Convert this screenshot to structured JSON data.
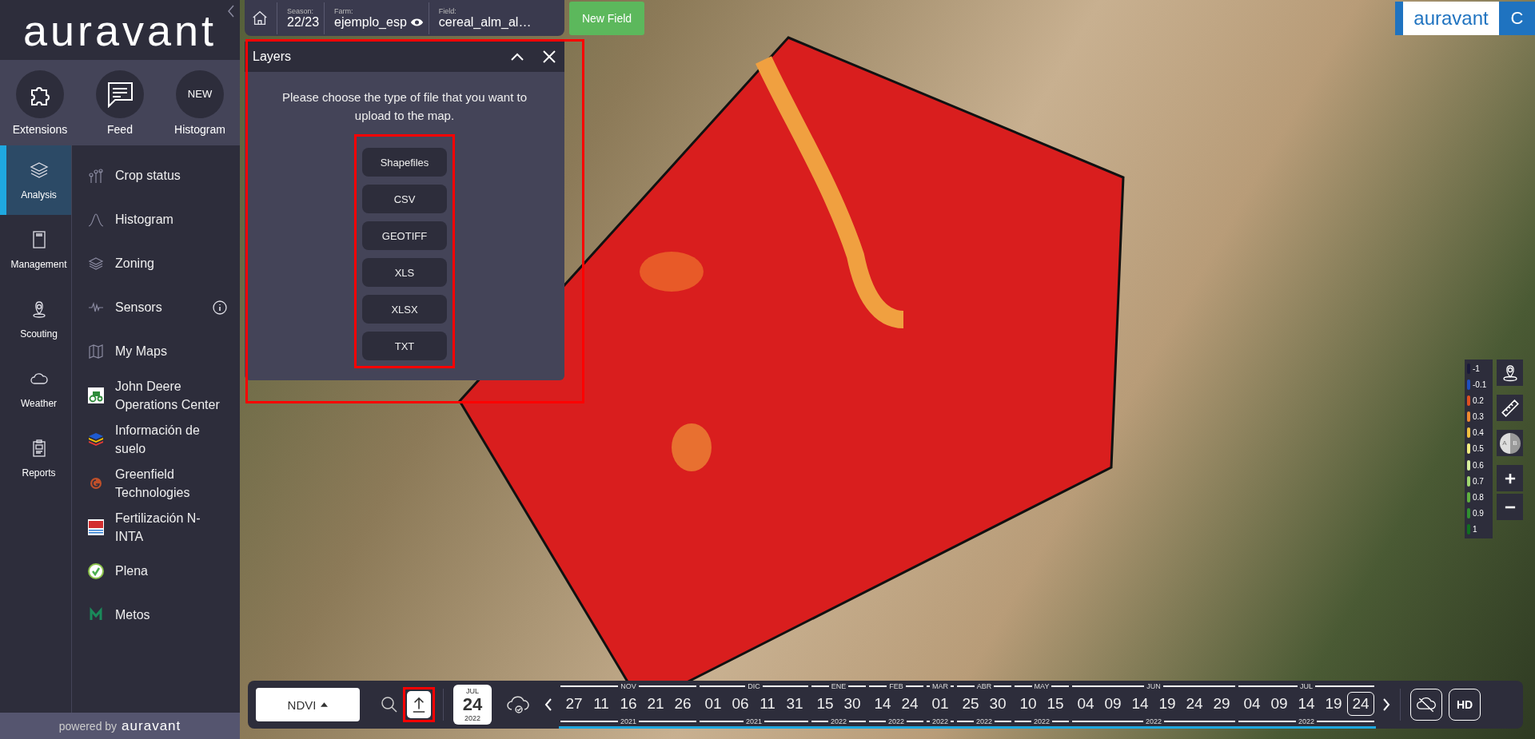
{
  "sidebar": {
    "logo": "auravant",
    "quick_actions": [
      {
        "label": "Extensions",
        "kind": "icon"
      },
      {
        "label": "Feed",
        "kind": "icon"
      },
      {
        "label": "Histogram",
        "kind": "text",
        "circle_text": "NEW"
      }
    ],
    "sections": [
      {
        "label": "Analysis",
        "selected": true
      },
      {
        "label": "Management",
        "selected": false
      },
      {
        "label": "Scouting",
        "selected": false
      },
      {
        "label": "Weather",
        "selected": false
      },
      {
        "label": "Reports",
        "selected": false
      }
    ],
    "menu": [
      {
        "label": "Crop status",
        "info": false
      },
      {
        "label": "Histogram",
        "info": false
      },
      {
        "label": "Zoning",
        "info": false
      },
      {
        "label": "Sensors",
        "info": true
      },
      {
        "label": "My Maps",
        "info": false
      },
      {
        "label": "John Deere Operations Center",
        "info": false
      },
      {
        "label": "Información de suelo",
        "info": false
      },
      {
        "label": "Greenfield Technologies",
        "info": false
      },
      {
        "label": "Fertilización N-INTA",
        "info": false
      },
      {
        "label": "Plena",
        "info": false
      },
      {
        "label": "Metos",
        "info": false
      }
    ],
    "footer": {
      "prefix": "powered by",
      "brand": "auravant"
    }
  },
  "breadcrumb": [
    {
      "label": "Season:",
      "value": "22/23"
    },
    {
      "label": "Farm:",
      "value": "ejemplo_esp"
    },
    {
      "label": "Field:",
      "value": "cereal_alm_al…"
    }
  ],
  "new_field_button": "New Field",
  "layers_panel": {
    "title": "Layers",
    "highlighted": true,
    "message": "Please choose the type of file that you want to upload to the map.",
    "options_highlighted": true,
    "options": [
      "Shapefiles",
      "CSV",
      "GEOTIFF",
      "XLS",
      "XLSX",
      "TXT"
    ]
  },
  "brand_badge": {
    "logo": "auravant",
    "letter": "C"
  },
  "legend": [
    {
      "value": "-1",
      "color": "#1a1a3a"
    },
    {
      "value": "-0.1",
      "color": "#1e4fc0"
    },
    {
      "value": "0.2",
      "color": "#e05020"
    },
    {
      "value": "0.3",
      "color": "#f08a30"
    },
    {
      "value": "0.4",
      "color": "#f0c040"
    },
    {
      "value": "0.5",
      "color": "#f4ee80"
    },
    {
      "value": "0.6",
      "color": "#d8f0a0"
    },
    {
      "value": "0.7",
      "color": "#a0d870"
    },
    {
      "value": "0.8",
      "color": "#60b040"
    },
    {
      "value": "0.9",
      "color": "#309030"
    },
    {
      "value": "1",
      "color": "#107020"
    }
  ],
  "compare": {
    "left": "A",
    "right": "B"
  },
  "toolbar": {
    "layer": "NDVI",
    "upload_highlighted": true,
    "date": {
      "month": "JUL",
      "day": "24",
      "year": "2022"
    },
    "hd": "HD",
    "months": [
      {
        "label": "NOV",
        "year": "2021",
        "days": [
          {
            "label": "27",
            "selected": false
          },
          {
            "label": "11",
            "selected": false
          },
          {
            "label": "16",
            "selected": false
          },
          {
            "label": "21",
            "selected": false
          },
          {
            "label": "26",
            "selected": false
          }
        ]
      },
      {
        "label": "DIC",
        "year": "2021",
        "days": [
          {
            "label": "01",
            "selected": false
          },
          {
            "label": "06",
            "selected": false
          },
          {
            "label": "11",
            "selected": false
          },
          {
            "label": "31",
            "selected": false
          }
        ]
      },
      {
        "label": "ENE",
        "year": "2022",
        "days": [
          {
            "label": "15",
            "selected": false
          },
          {
            "label": "30",
            "selected": false
          }
        ]
      },
      {
        "label": "FEB",
        "year": "2022",
        "days": [
          {
            "label": "14",
            "selected": false
          },
          {
            "label": "24",
            "selected": false
          }
        ]
      },
      {
        "label": "MAR",
        "year": "2022",
        "days": [
          {
            "label": "01",
            "selected": false
          }
        ]
      },
      {
        "label": "ABR",
        "year": "2022",
        "days": [
          {
            "label": "25",
            "selected": false
          },
          {
            "label": "30",
            "selected": false
          }
        ]
      },
      {
        "label": "MAY",
        "year": "2022",
        "days": [
          {
            "label": "10",
            "selected": false
          },
          {
            "label": "15",
            "selected": false
          }
        ]
      },
      {
        "label": "JUN",
        "year": "2022",
        "days": [
          {
            "label": "04",
            "selected": false
          },
          {
            "label": "09",
            "selected": false
          },
          {
            "label": "14",
            "selected": false
          },
          {
            "label": "19",
            "selected": false
          },
          {
            "label": "24",
            "selected": false
          },
          {
            "label": "29",
            "selected": false
          }
        ]
      },
      {
        "label": "JUL",
        "year": "2022",
        "days": [
          {
            "label": "04",
            "selected": false
          },
          {
            "label": "09",
            "selected": false
          },
          {
            "label": "14",
            "selected": false
          },
          {
            "label": "19",
            "selected": false
          },
          {
            "label": "24",
            "selected": true
          }
        ]
      }
    ]
  }
}
